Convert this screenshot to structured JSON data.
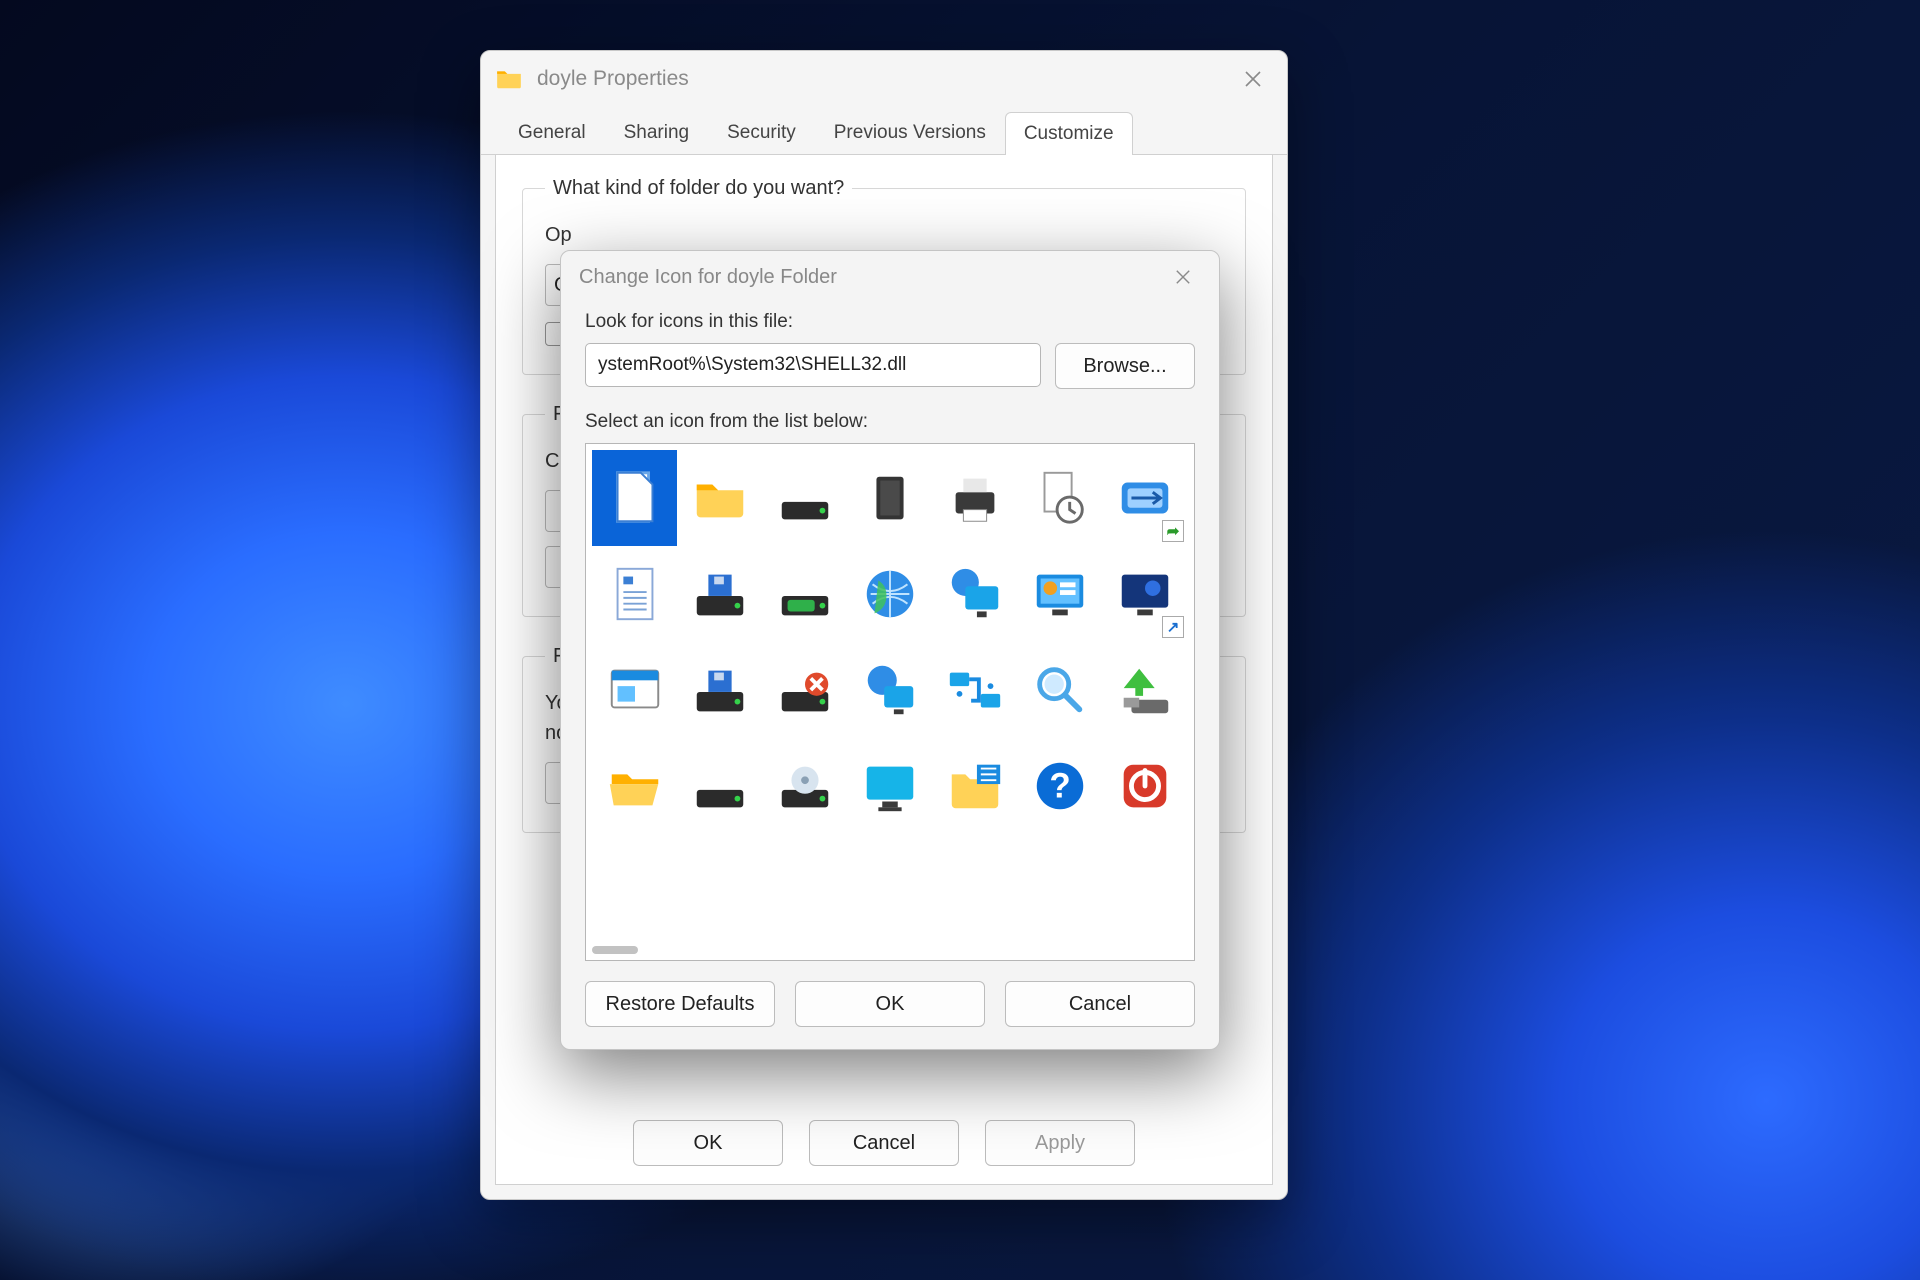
{
  "properties": {
    "title": "doyle Properties",
    "tabs": [
      "General",
      "Sharing",
      "Security",
      "Previous Versions",
      "Customize"
    ],
    "active_tab": "Customize",
    "groups": {
      "kind": {
        "legend": "What kind of folder do you want?",
        "line": "Op",
        "button_stub": "G"
      },
      "files": {
        "legend_stub": "Fol",
        "line": "Ch"
      },
      "icons": {
        "legend_stub": "Fol",
        "line1": "Yo",
        "line2": "no"
      }
    },
    "buttons": {
      "ok": "OK",
      "cancel": "Cancel",
      "apply": "Apply"
    }
  },
  "change_icon": {
    "title": "Change Icon for doyle Folder",
    "look_label": "Look for icons in this file:",
    "path_value": "ystemRoot%\\System32\\SHELL32.dll",
    "browse": "Browse...",
    "select_label": "Select an icon from the list below:",
    "icons": [
      {
        "name": "blank-document-icon",
        "selected": true
      },
      {
        "name": "folder-icon"
      },
      {
        "name": "drive-icon"
      },
      {
        "name": "chip-icon"
      },
      {
        "name": "printer-icon"
      },
      {
        "name": "recent-document-icon"
      },
      {
        "name": "run-icon",
        "badge": "share"
      },
      {
        "name": "text-document-icon"
      },
      {
        "name": "floppy-drive-icon"
      },
      {
        "name": "removable-drive-icon"
      },
      {
        "name": "globe-icon"
      },
      {
        "name": "network-monitor-icon"
      },
      {
        "name": "control-panel-icon"
      },
      {
        "name": "screensaver-icon",
        "badge": "shortcut"
      },
      {
        "name": "program-window-icon"
      },
      {
        "name": "floppy-drive-alt-icon"
      },
      {
        "name": "disconnect-drive-icon"
      },
      {
        "name": "network-globe-icon"
      },
      {
        "name": "network-connections-icon"
      },
      {
        "name": "search-icon"
      },
      {
        "name": "eject-drive-icon"
      },
      {
        "name": "open-folder-icon"
      },
      {
        "name": "hard-drive-icon"
      },
      {
        "name": "optical-drive-icon"
      },
      {
        "name": "monitor-icon"
      },
      {
        "name": "folder-options-icon"
      },
      {
        "name": "help-icon"
      },
      {
        "name": "shutdown-icon"
      }
    ],
    "buttons": {
      "restore": "Restore Defaults",
      "ok": "OK",
      "cancel": "Cancel"
    }
  }
}
